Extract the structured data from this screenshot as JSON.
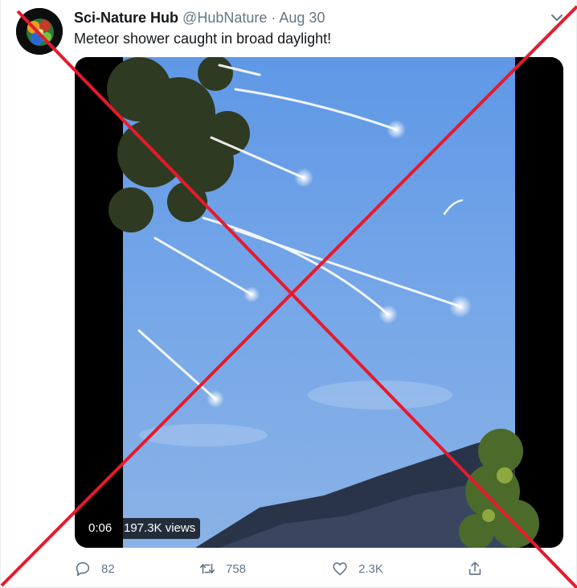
{
  "tweet": {
    "author_name": "Sci-Nature Hub",
    "author_handle": "@HubNature",
    "separator": "·",
    "date": "Aug 30",
    "text": "Meteor shower caught in broad daylight!"
  },
  "video": {
    "duration": "0:06",
    "views": "197.3K views"
  },
  "actions": {
    "reply_count": "82",
    "retweet_count": "758",
    "like_count": "2.3K"
  },
  "colors": {
    "text_primary": "#14171a",
    "text_secondary": "#657786",
    "cross_mark": "#e8192c",
    "sky": "#6f9fe0"
  },
  "icons": {
    "reply": "reply-icon",
    "retweet": "retweet-icon",
    "like": "heart-icon",
    "share": "share-icon",
    "more": "chevron-down-icon"
  }
}
